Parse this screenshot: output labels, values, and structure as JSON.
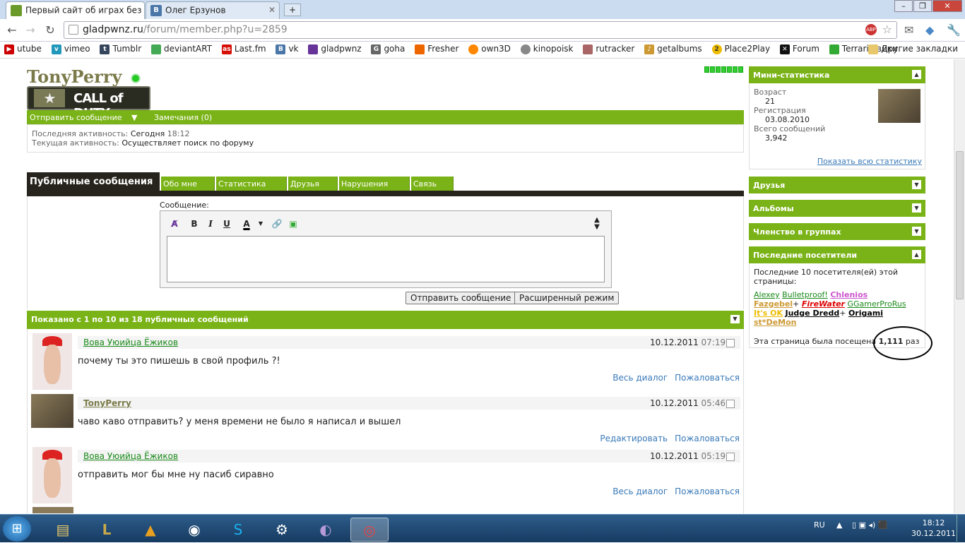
{
  "browser": {
    "tabs": [
      {
        "label": "Первый сайт об играх без"
      },
      {
        "label": "Олег Ерзунов"
      }
    ],
    "url_host": "gladpwnz.ru",
    "url_path": "/forum/member.php?u=2859",
    "bookmarks": [
      "utube",
      "vimeo",
      "Tumblr",
      "deviantART",
      "Last.fm",
      "vk",
      "gladpwnz",
      "goha",
      "Fresher",
      "own3D",
      "kinopoisk",
      "rutracker",
      "getalbums",
      "Place2Play",
      "Forum",
      "Terraria вики"
    ],
    "other_bookmarks": "Другие закладки"
  },
  "profile": {
    "username": "TonyPerry",
    "banner_text": "CALL of DUTY",
    "send_message": "Отправить сообщение",
    "remarks": "Замечания (0)",
    "last_activity_label": "Последняя активность:",
    "last_activity_date": "Сегодня",
    "last_activity_time": "18:12",
    "current_activity_label": "Текущая активность:",
    "current_activity_value": "Осуществляет поиск по форуму"
  },
  "tabs": {
    "public": "Публичные сообщения",
    "items": [
      "Обо мне",
      "Статистика",
      "Друзья",
      "Нарушения",
      "Связь"
    ]
  },
  "form": {
    "message_label": "Сообщение:",
    "send_btn": "Отправить сообщение",
    "advanced_btn": "Расширенный режим"
  },
  "list_header": "Показано с 1 по 10 из 18 публичных сообщений",
  "messages": [
    {
      "author": "Вова Уюийца Ёжиков",
      "date": "10.12.2011",
      "time": "07:19",
      "text": "почему ты это пишешь в свой профиль ?!",
      "link1": "Весь диалог",
      "link2": "Пожаловаться"
    },
    {
      "author": "TonyPerry",
      "date": "10.12.2011",
      "time": "05:46",
      "text": "чаво каво отправить? у меня времени не было я написал и вышел",
      "link1": "Редактировать",
      "link2": "Пожаловаться"
    },
    {
      "author": "Вова Уюийца Ёжиков",
      "date": "10.12.2011",
      "time": "05:19",
      "text": "отправить мог бы мне ну пасиб сиравно",
      "link1": "Весь диалог",
      "link2": "Пожаловаться"
    }
  ],
  "sidebar": {
    "mini_stats": "Мини-статистика",
    "age_label": "Возраст",
    "age": "21",
    "reg_label": "Регистрация",
    "reg": "03.08.2010",
    "posts_label": "Всего сообщений",
    "posts": "3,942",
    "show_all": "Показать всю статистику",
    "friends": "Друзья",
    "albums": "Альбомы",
    "groups": "Членство в группах",
    "visitors": "Последние посетители",
    "visitors_intro": "Последние 10 посетителя(ей) этой страницы:",
    "visitor_names": [
      "Alexey",
      "Bulletproof!",
      "Chlenios",
      "Fazgebel",
      "FireWater",
      "GGamerProRus",
      "It's OK",
      "Judge Dredd",
      "Origami",
      "st*DeMon"
    ],
    "visits_prefix": "Эта страница была посещена",
    "visits": "1,111",
    "visits_suffix": "раз"
  },
  "taskbar": {
    "lang": "RU",
    "time": "18:12",
    "date": "30.12.2011"
  }
}
